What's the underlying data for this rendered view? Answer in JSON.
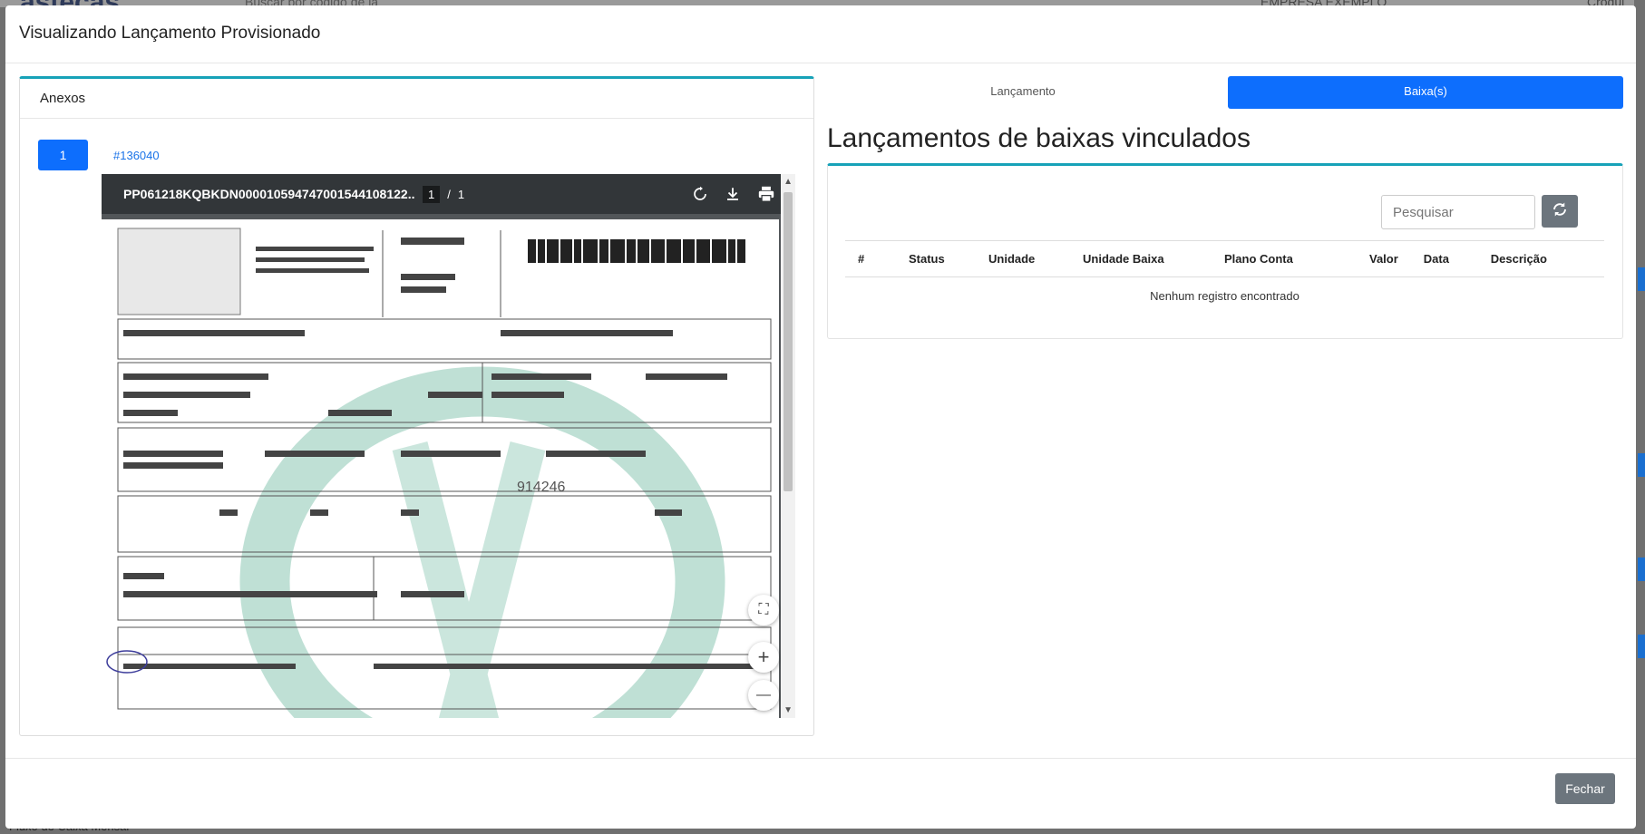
{
  "background": {
    "brand": "astecas",
    "search_placeholder": "Buscar por código de la",
    "company": "EMPRESA EXEMPLO",
    "user": "Croqui",
    "footer_text": "Fluxo de Caixa Mensal"
  },
  "modal": {
    "title": "Visualizando Lançamento Provisionado",
    "close_label": "Fechar"
  },
  "anexos": {
    "heading": "Anexos",
    "page_button": "1",
    "attachment_link": "#136040",
    "pdf": {
      "filename": "PP061218KQBKDN000010594747001544108122...",
      "current_page": "1",
      "page_separator": "/",
      "total_pages": "1",
      "icons": [
        "rotate-icon",
        "download-icon",
        "print-icon"
      ]
    },
    "zoom": {
      "fit": "⛶",
      "in": "+",
      "out": "—"
    }
  },
  "right": {
    "tabs": [
      {
        "label": "Lançamento",
        "active": false
      },
      {
        "label": "Baixa(s)",
        "active": true
      }
    ],
    "title": "Lançamentos de baixas vinculados",
    "search_placeholder": "Pesquisar",
    "table": {
      "columns": [
        "#",
        "Status",
        "Unidade",
        "Unidade Baixa",
        "Plano Conta",
        "Valor",
        "Data",
        "Descrição"
      ],
      "empty_message": "Nenhum registro encontrado"
    }
  },
  "colors": {
    "accent": "#0d6efd",
    "teal_border": "#17a2b8",
    "secondary": "#6c757d"
  }
}
